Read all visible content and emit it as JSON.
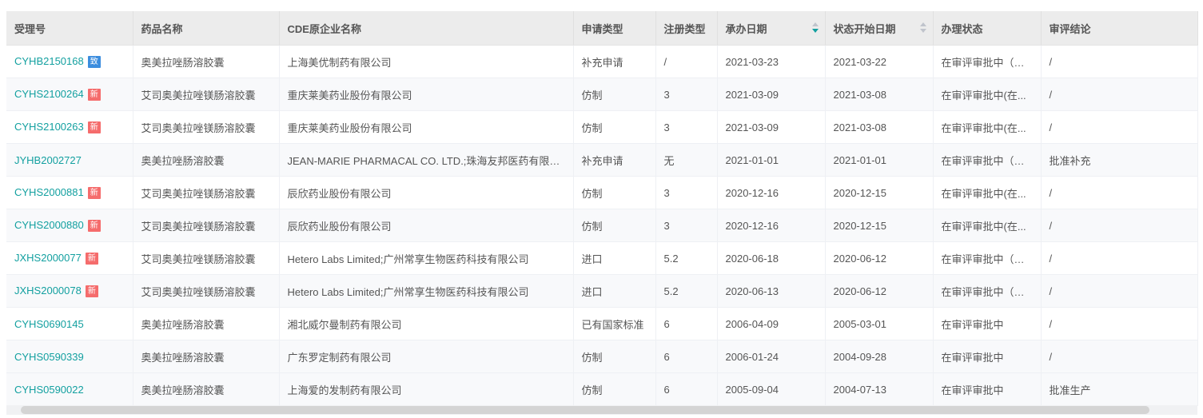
{
  "columns": [
    "受理号",
    "药品名称",
    "CDE原企业名称",
    "申请类型",
    "注册类型",
    "承办日期",
    "状态开始日期",
    "办理状态",
    "审评结论"
  ],
  "colors": {
    "link": "#13a0a0",
    "badge_zhi": "#3c8dde",
    "badge_xin": "#f56c6c"
  },
  "rows": [
    {
      "id": "CYHB2150168",
      "badge": "致",
      "badge_color": "#3c8dde",
      "drug": "奥美拉唑肠溶胶囊",
      "company": "上海美优制药有限公司",
      "app_type": "补充申请",
      "reg_type": "/",
      "date": "2021-03-23",
      "status_date": "2021-03-22",
      "status": "在审评审批中（在...",
      "conclusion": "/"
    },
    {
      "id": "CYHS2100264",
      "badge": "新",
      "badge_color": "#f56c6c",
      "drug": "艾司奥美拉唑镁肠溶胶囊",
      "company": "重庆莱美药业股份有限公司",
      "app_type": "仿制",
      "reg_type": "3",
      "date": "2021-03-09",
      "status_date": "2021-03-08",
      "status": "在审评审批中(在...",
      "conclusion": "/"
    },
    {
      "id": "CYHS2100263",
      "badge": "新",
      "badge_color": "#f56c6c",
      "drug": "艾司奥美拉唑镁肠溶胶囊",
      "company": "重庆莱美药业股份有限公司",
      "app_type": "仿制",
      "reg_type": "3",
      "date": "2021-03-09",
      "status_date": "2021-03-08",
      "status": "在审评审批中(在...",
      "conclusion": "/"
    },
    {
      "id": "JYHB2002727",
      "badge": "",
      "badge_color": "",
      "drug": "奥美拉唑肠溶胶囊",
      "company": "JEAN-MARIE PHARMACAL CO. LTD.;珠海友邦医药有限公司",
      "app_type": "补充申请",
      "reg_type": "无",
      "date": "2021-01-01",
      "status_date": "2021-01-01",
      "status": "在审评审批中（在...",
      "conclusion": "批准补充"
    },
    {
      "id": "CYHS2000881",
      "badge": "新",
      "badge_color": "#f56c6c",
      "drug": "艾司奥美拉唑镁肠溶胶囊",
      "company": "辰欣药业股份有限公司",
      "app_type": "仿制",
      "reg_type": "3",
      "date": "2020-12-16",
      "status_date": "2020-12-15",
      "status": "在审评审批中(在...",
      "conclusion": "/"
    },
    {
      "id": "CYHS2000880",
      "badge": "新",
      "badge_color": "#f56c6c",
      "drug": "艾司奥美拉唑镁肠溶胶囊",
      "company": "辰欣药业股份有限公司",
      "app_type": "仿制",
      "reg_type": "3",
      "date": "2020-12-16",
      "status_date": "2020-12-15",
      "status": "在审评审批中(在...",
      "conclusion": "/"
    },
    {
      "id": "JXHS2000077",
      "badge": "新",
      "badge_color": "#f56c6c",
      "drug": "艾司奥美拉唑镁肠溶胶囊",
      "company": "Hetero Labs Limited;广州常享生物医药科技有限公司",
      "app_type": "进口",
      "reg_type": "5.2",
      "date": "2020-06-18",
      "status_date": "2020-06-12",
      "status": "在审评审批中（在...",
      "conclusion": "/"
    },
    {
      "id": "JXHS2000078",
      "badge": "新",
      "badge_color": "#f56c6c",
      "drug": "艾司奥美拉唑镁肠溶胶囊",
      "company": "Hetero Labs Limited;广州常享生物医药科技有限公司",
      "app_type": "进口",
      "reg_type": "5.2",
      "date": "2020-06-13",
      "status_date": "2020-06-12",
      "status": "在审评审批中（在...",
      "conclusion": "/"
    },
    {
      "id": "CYHS0690145",
      "badge": "",
      "badge_color": "",
      "drug": "奥美拉唑肠溶胶囊",
      "company": "湘北威尔曼制药有限公司",
      "app_type": "已有国家标准",
      "reg_type": "6",
      "date": "2006-04-09",
      "status_date": "2005-03-01",
      "status": "在审评审批中",
      "conclusion": "/"
    },
    {
      "id": "CYHS0590339",
      "badge": "",
      "badge_color": "",
      "drug": "奥美拉唑肠溶胶囊",
      "company": "广东罗定制药有限公司",
      "app_type": "仿制",
      "reg_type": "6",
      "date": "2006-01-24",
      "status_date": "2004-09-28",
      "status": "在审评审批中",
      "conclusion": "/"
    },
    {
      "id": "CYHS0590022",
      "badge": "",
      "badge_color": "",
      "drug": "奥美拉唑肠溶胶囊",
      "company": "上海爱的发制药有限公司",
      "app_type": "仿制",
      "reg_type": "6",
      "date": "2005-09-04",
      "status_date": "2004-07-13",
      "status": "在审评审批中",
      "conclusion": "批准生产"
    }
  ]
}
